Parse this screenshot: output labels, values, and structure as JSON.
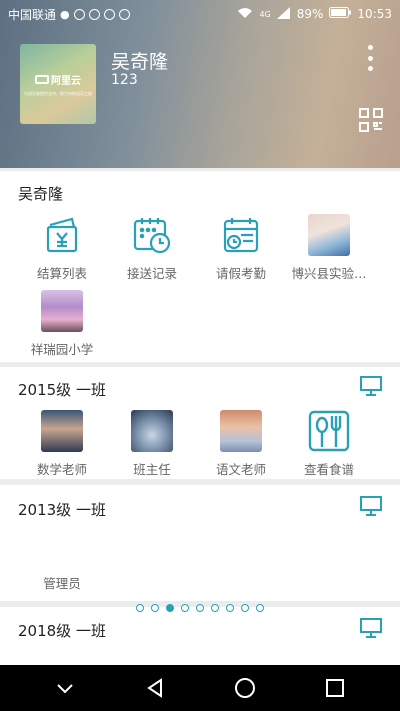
{
  "status_bar": {
    "carrier": "中国联通",
    "battery": "89%",
    "time": "10:53",
    "network": "4G"
  },
  "header": {
    "name": "吴奇隆",
    "id": "123",
    "cover_logo": "阿里云",
    "cover_slogan": "为成功者提供支持，助力你的成功之路"
  },
  "profile_card": {
    "title": "吴奇隆",
    "items": [
      {
        "label": "结算列表",
        "icon": "wallet-icon"
      },
      {
        "label": "接送记录",
        "icon": "calendar-clock-icon"
      },
      {
        "label": "请假考勤",
        "icon": "leave-calendar-icon"
      },
      {
        "label": "博兴县实验…",
        "icon": "photo"
      },
      {
        "label": "祥瑞园小学",
        "icon": "photo"
      }
    ]
  },
  "class_2015": {
    "title": "2015级 一班",
    "items": [
      {
        "label": "数学老师"
      },
      {
        "label": "班主任"
      },
      {
        "label": "语文老师"
      },
      {
        "label": "查看食谱"
      }
    ]
  },
  "class_2013": {
    "title": "2013级 一班",
    "items": [
      {
        "label": "管理员"
      }
    ]
  },
  "class_2018": {
    "title": "2018级 一班"
  },
  "pager": {
    "count": 9,
    "active": 2
  },
  "colors": {
    "accent": "#2aa0b6"
  }
}
